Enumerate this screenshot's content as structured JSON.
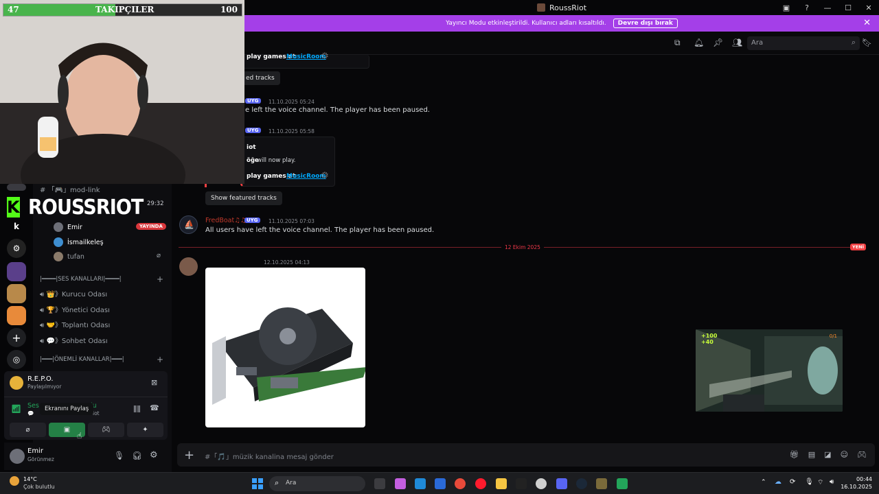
{
  "window": {
    "title": "RoussRiot"
  },
  "banner": {
    "text": "Yayıncı Modu etkinleştirildi. Kullanıcı adları kısaltıldı.",
    "button": "Devre dışı bırak"
  },
  "header": {
    "search_placeholder": "Ara"
  },
  "overlay": {
    "followers_label": "TAKIPÇILER",
    "followers_current": "47",
    "followers_goal": "100",
    "followers_progress": 0.47,
    "logo_letter": "K",
    "streamer_name": "ROUSSRIOT",
    "timer": "29:32"
  },
  "sidebar": {
    "mod_link": "「🎮」mod-link",
    "voice_users": [
      {
        "name": "Emir",
        "live": "YAYINDA"
      },
      {
        "name": "İsmailkeleş"
      },
      {
        "name": "tufan"
      }
    ],
    "category_voice": "|━━━━|SES KANALLARI|━━━━|",
    "voice_channels": [
      {
        "label": "👑》Kurucu Odası"
      },
      {
        "label": "🏆》Yönetici Odası"
      },
      {
        "label": "🤝》Toplantı Odası"
      },
      {
        "label": "💬》Sohbet Odası"
      }
    ],
    "category_important": "|━━━|ÖNEMLİ KANALLAR|━━━|",
    "rail_text_item": "k"
  },
  "voice_panel": {
    "activity_title": "R.E.P.O.",
    "activity_sub": "Paylaşılmıyor",
    "connection_title": "Ses",
    "connection_title_tail": "lu",
    "connection_sub": "💬",
    "connection_sub_tail": "iot",
    "tooltip": "Ekranını Paylaş"
  },
  "user_panel": {
    "name": "Emir",
    "status": "Görünmez"
  },
  "chat": {
    "msg_a_link_text": "play games at",
    "msg_a_link": "MusicRoom",
    "featured_partial": "ed tracks",
    "app_tag": "UYG",
    "msg1_time": "11.10.2025 05:24",
    "msg1_text": "e left the voice channel. The player has been paused.",
    "msg2_time": "11.10.2025 05:58",
    "embed2_title": "iot",
    "embed2_line_bold": "öğe",
    "embed2_line_rest": " will now play.",
    "featured_button": "Show featured tracks",
    "msg3_author": "FredBoat♫♫",
    "msg3_time": "11.10.2025 07:03",
    "msg3_text": "All users have left the voice channel. The player has been paused.",
    "date_divider": "12 Ekim 2025",
    "new_tag": "YENİ",
    "msg4_time": "12.10.2025 04:13"
  },
  "composer": {
    "placeholder": "#「🎵」müzik kanalina mesaj gönder"
  },
  "game_overlay": {
    "hud_top": "+100",
    "hud_bottom": "+40",
    "hud_right": "0/1"
  },
  "taskbar": {
    "weather_temp": "14°C",
    "weather_desc": "Çok bulutlu",
    "search_label": "Ara",
    "time": "00:44",
    "date": "16.10.2025"
  },
  "colors": {
    "accent": "#5865f2",
    "banner": "#a43fe8",
    "kick_green": "#53fc18",
    "live_red": "#da373c"
  }
}
